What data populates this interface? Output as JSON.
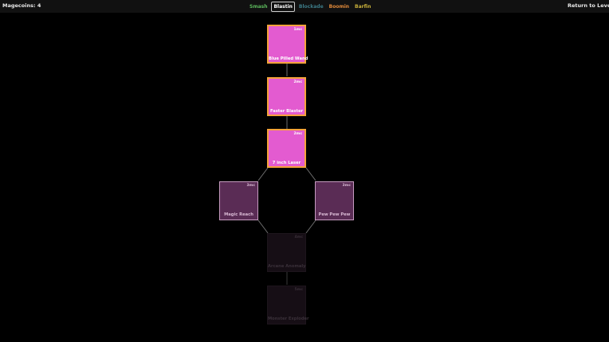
{
  "header": {
    "magecoins_label": "Magecoins: 4",
    "return_label": "Return to Level Selec"
  },
  "tabs": [
    {
      "label": "Smash",
      "color": "#5cb85c",
      "active": false
    },
    {
      "label": "Blastin",
      "color": "#ffffff",
      "active": true
    },
    {
      "label": "Blockade",
      "color": "#3c7a86",
      "active": false
    },
    {
      "label": "Boomin",
      "color": "#e0893a",
      "active": false
    },
    {
      "label": "Barfin",
      "color": "#c8b03a",
      "active": false
    }
  ],
  "upgrades": [
    {
      "name": "Blue Pilled Wand",
      "cost": "1mc",
      "state": "owned"
    },
    {
      "name": "Faster Blaster",
      "cost": "2mc",
      "state": "owned"
    },
    {
      "name": "7 inch Laser",
      "cost": "2mc",
      "state": "owned"
    },
    {
      "name": "Magic Reach",
      "cost": "3mc",
      "state": "available"
    },
    {
      "name": "Pew Pew Pew",
      "cost": "3mc",
      "state": "available"
    },
    {
      "name": "Arcane Anomaly",
      "cost": "4mc",
      "state": "locked"
    },
    {
      "name": "Monster Exploder",
      "cost": "5mc",
      "state": "locked"
    }
  ],
  "colors": {
    "owned_fill": "#e35bd0",
    "owned_border": "#f5a33a",
    "available_fill": "#5a2c55",
    "locked_fill": "#160e15",
    "link": "#6e6e6e"
  }
}
